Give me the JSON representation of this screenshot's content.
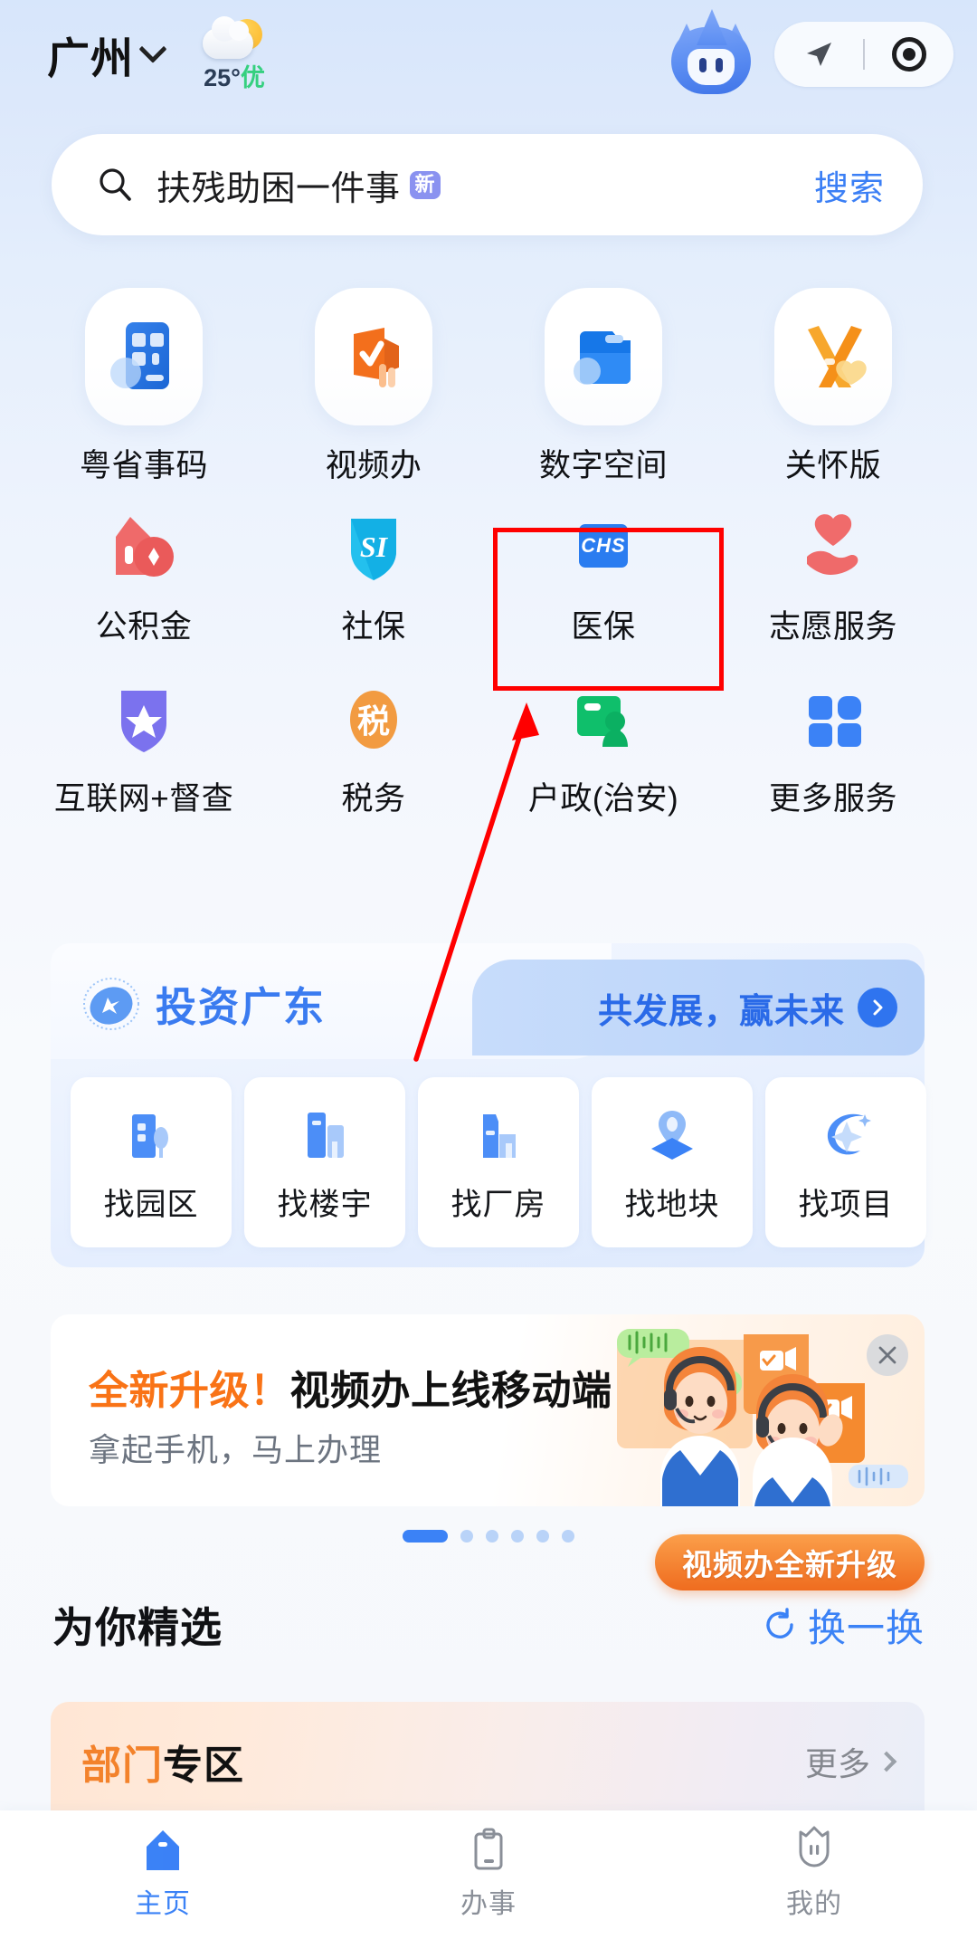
{
  "header": {
    "city": "广州",
    "city_chevron_icon": "chevron-down-icon",
    "weather": {
      "icon": "sun-behind-cloud-icon",
      "temperature": "25°",
      "air_quality": "优"
    },
    "mascot_icon": "mascot-avatar-icon",
    "capsule": {
      "nav_icon": "navigation-arrow-icon",
      "target_icon": "target-record-icon"
    }
  },
  "search": {
    "icon": "search-icon",
    "value": "扶残助困一件事",
    "badge": "新",
    "button_label": "搜索"
  },
  "app_grid": {
    "row1": [
      {
        "label": "粤省事码",
        "icon": "qr-card-icon"
      },
      {
        "label": "视频办",
        "icon": "video-check-icon"
      },
      {
        "label": "数字空间",
        "icon": "digital-folder-icon"
      },
      {
        "label": "关怀版",
        "icon": "care-ribbon-icon"
      }
    ],
    "row2": [
      {
        "label": "公积金",
        "icon": "house-fund-icon"
      },
      {
        "label": "社保",
        "icon": "social-insurance-shield-icon"
      },
      {
        "label": "医保",
        "icon": "chs-medical-card-icon",
        "highlighted": true
      },
      {
        "label": "志愿服务",
        "icon": "heart-hand-icon"
      }
    ],
    "row3": [
      {
        "label": "互联网+督查",
        "icon": "star-shield-icon"
      },
      {
        "label": "税务",
        "icon": "tax-oval-icon"
      },
      {
        "label": "户政(治安)",
        "icon": "household-id-icon"
      },
      {
        "label": "更多服务",
        "icon": "grid-more-icon"
      }
    ]
  },
  "invest_card": {
    "logo_icon": "invest-globe-icon",
    "title": "投资广东",
    "tagline": "共发展，赢未来",
    "tagline_chevron_icon": "chevron-right-icon",
    "items": [
      {
        "label": "找园区",
        "icon": "park-building-icon"
      },
      {
        "label": "找楼宇",
        "icon": "tower-building-icon"
      },
      {
        "label": "找厂房",
        "icon": "factory-icon"
      },
      {
        "label": "找地块",
        "icon": "land-pin-icon"
      },
      {
        "label": "找项目",
        "icon": "project-spark-icon"
      }
    ]
  },
  "video_banner": {
    "title_highlight": "全新升级！",
    "title_rest": "视频办上线移动端",
    "subtitle": "拿起手机，马上办理",
    "close_icon": "close-icon",
    "illustration_icon": "customer-service-agents-icon",
    "pill_label": "视频办全新升级"
  },
  "carousel": {
    "total_dots": 6,
    "active_index": 0
  },
  "featured_section": {
    "title": "为你精选",
    "refresh_icon": "refresh-icon",
    "refresh_label": "换一换"
  },
  "dept_card": {
    "title_orange": "部门",
    "title_black": "专区",
    "more_label": "更多",
    "more_chevron_icon": "chevron-right-icon"
  },
  "tabbar": [
    {
      "label": "主页",
      "icon": "home-icon",
      "active": true
    },
    {
      "label": "办事",
      "icon": "clipboard-icon",
      "active": false
    },
    {
      "label": "我的",
      "icon": "profile-mascot-icon",
      "active": false
    }
  ],
  "annotation": {
    "box_color": "#ff0000",
    "arrow_color": "#ff0000",
    "target": "医保"
  },
  "colors": {
    "accent_blue": "#3b82f6",
    "link_blue": "#3b7ff5",
    "orange": "#f97316",
    "green": "#35d07f",
    "bg_top": "#d7e6fb",
    "bg_bottom": "#f6f8fc"
  }
}
